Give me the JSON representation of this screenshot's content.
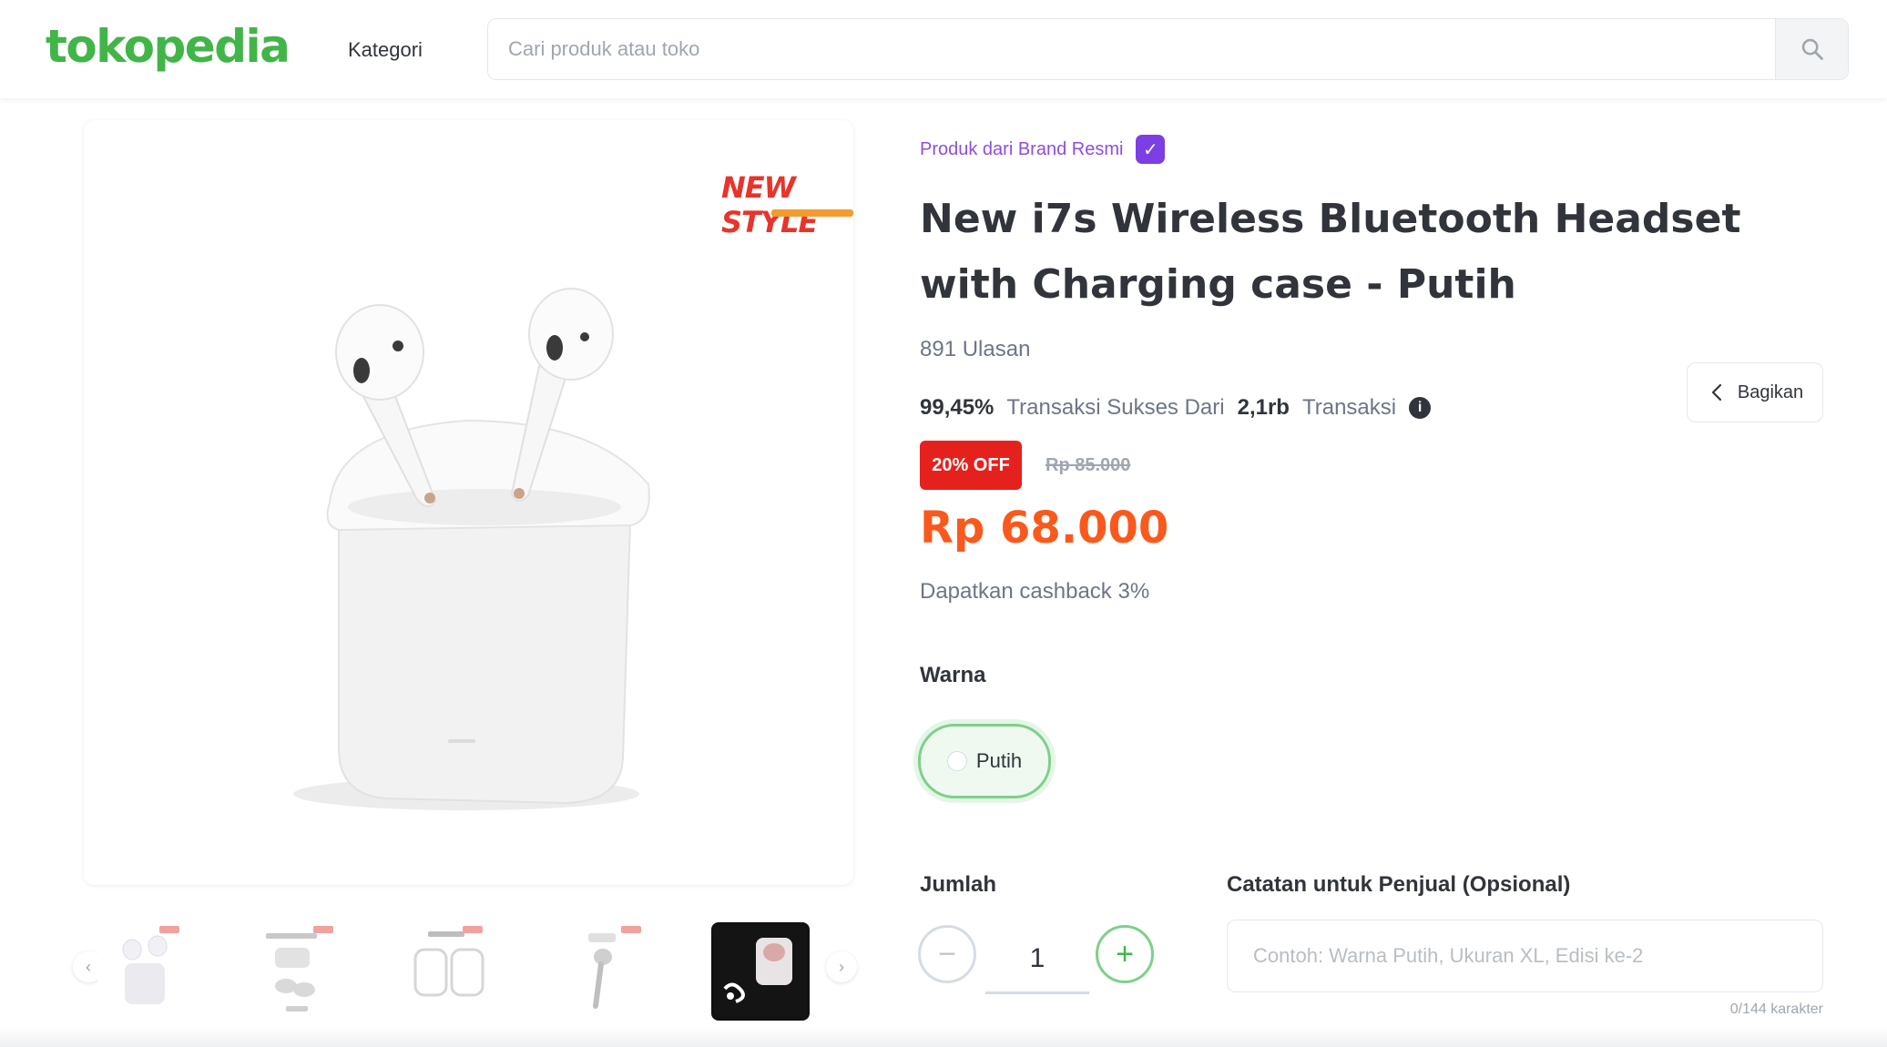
{
  "header": {
    "logo": "tokopedia",
    "kategori": "Kategori",
    "search_placeholder": "Cari produk atau toko"
  },
  "gallery": {
    "main_badge": "NEW STYLE",
    "thumbnails_count": 5,
    "active_thumbnail": 5
  },
  "product": {
    "brand_line": "Produk dari Brand Resmi",
    "title": "New i7s Wireless Bluetooth Headset with Charging case - Putih",
    "review_count": "891 Ulasan",
    "stats": {
      "success_rate": "99,45%",
      "label_1": "Transaksi Sukses Dari",
      "transactions": "2,1rb",
      "label_2": "Transaksi"
    },
    "share_label": "Bagikan",
    "discount": "20% OFF",
    "old_price": "Rp 85.000",
    "price": "Rp 68.000",
    "cashback": "Dapatkan cashback 3%"
  },
  "variant": {
    "label": "Warna",
    "selected": "Putih"
  },
  "quantity": {
    "label": "Jumlah",
    "value": "1"
  },
  "notes": {
    "label": "Catatan untuk Penjual (Opsional)",
    "placeholder": "Contoh: Warna Putih, Ukuran XL, Edisi ke-2",
    "counter": "0/144 karakter"
  },
  "colors": {
    "brand_green": "#42b549",
    "price_orange": "#fa591d",
    "discount_red": "#e5211d",
    "official_purple": "#7b3fe4"
  }
}
